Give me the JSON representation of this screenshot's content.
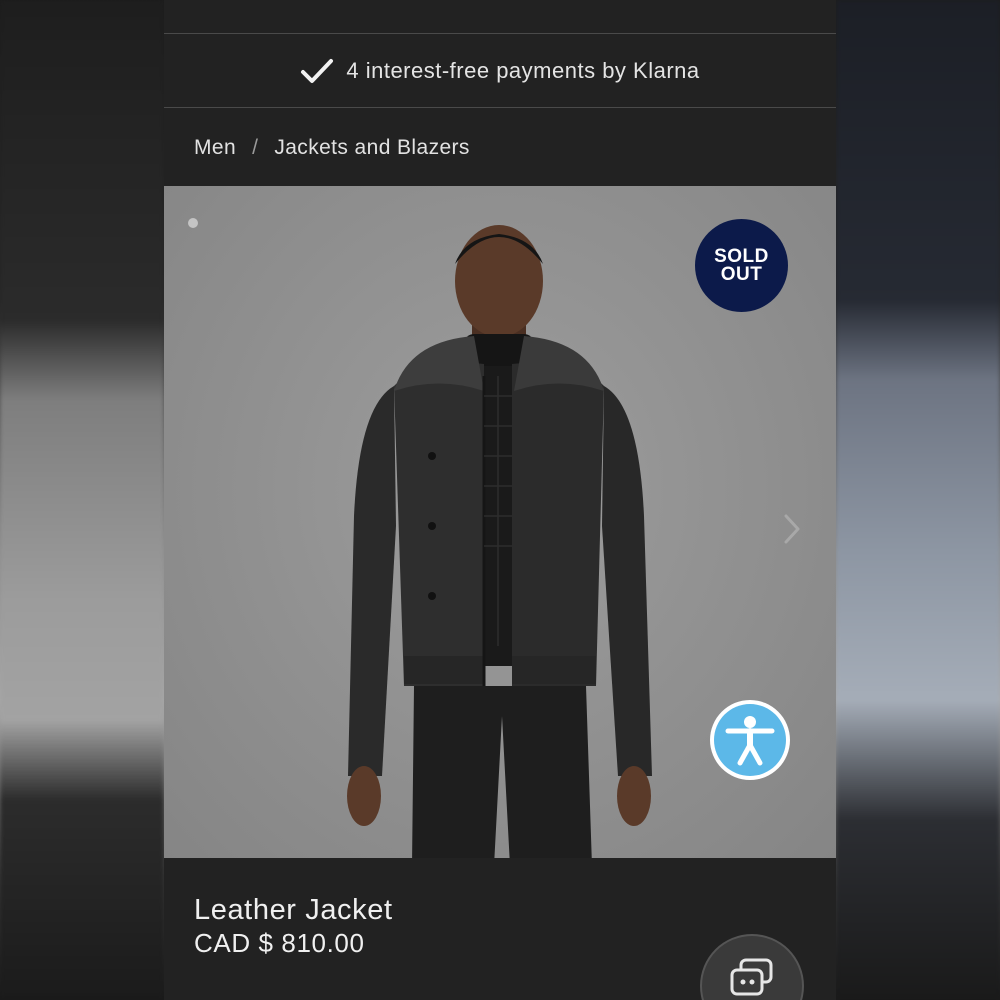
{
  "banner": {
    "klarna_text": "4 interest-free payments by Klarna",
    "icon": "check-icon"
  },
  "breadcrumb": {
    "items": [
      "Men",
      "Jackets and Blazers"
    ],
    "separator": "/"
  },
  "product": {
    "badge_line1": "SOLD",
    "badge_line2": "OUT",
    "title": "Leather Jacket",
    "price": "CAD $ 810.00",
    "badge_color": "#0c1a4a"
  },
  "icons": {
    "next": "chevron-right-icon",
    "accessibility": "accessibility-icon",
    "chat": "chat-icon"
  },
  "colors": {
    "background": "#222222",
    "accessibility_blue": "#5cb8e8"
  }
}
